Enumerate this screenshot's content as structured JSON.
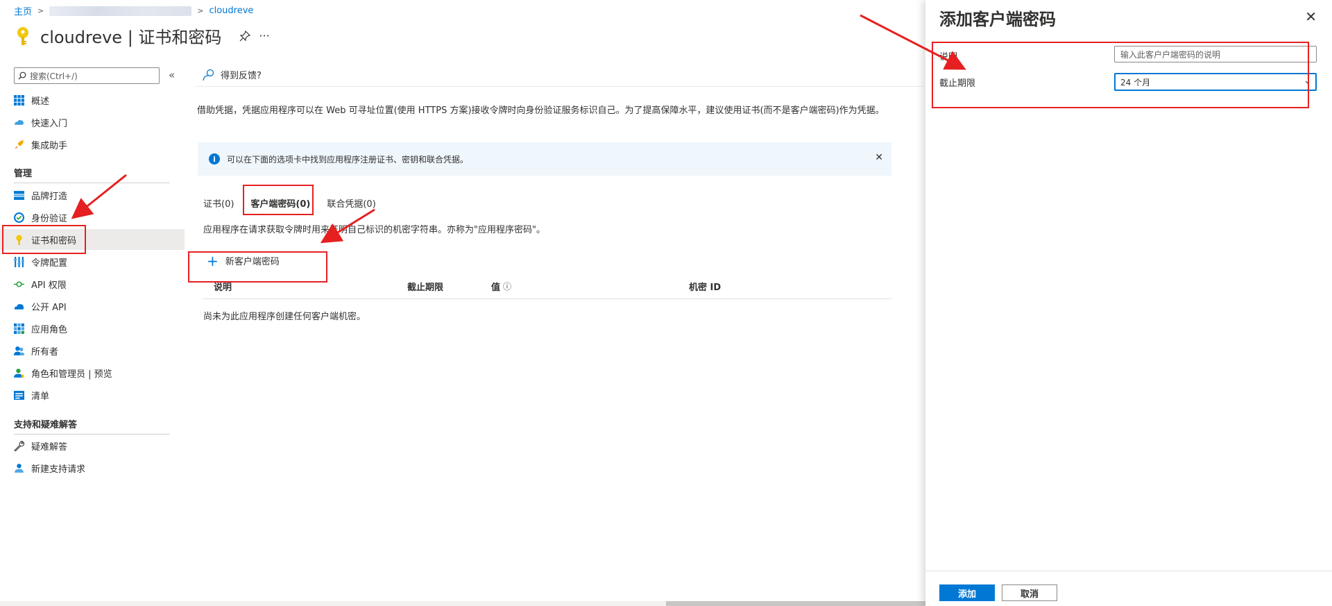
{
  "breadcrumb": {
    "home": "主页",
    "current": "cloudreve"
  },
  "header": {
    "title": "cloudreve | 证书和密码",
    "pin_icon": "pin-icon",
    "more_label": "···"
  },
  "sidebar": {
    "search_placeholder": "搜索(Ctrl+/)",
    "collapse_label": "«",
    "items_top": [
      {
        "label": "概述",
        "icon": "overview-icon"
      },
      {
        "label": "快速入门",
        "icon": "quickstart-icon"
      },
      {
        "label": "集成助手",
        "icon": "rocket-icon"
      }
    ],
    "section_manage": "管理",
    "items_manage": [
      {
        "label": "品牌打造",
        "icon": "branding-icon"
      },
      {
        "label": "身份验证",
        "icon": "auth-icon"
      },
      {
        "label": "证书和密码",
        "icon": "key-icon"
      },
      {
        "label": "令牌配置",
        "icon": "token-icon"
      },
      {
        "label": "API 权限",
        "icon": "api-permission-icon"
      },
      {
        "label": "公开 API",
        "icon": "cloud-icon"
      },
      {
        "label": "应用角色",
        "icon": "grid-icon"
      },
      {
        "label": "所有者",
        "icon": "owners-icon"
      },
      {
        "label": "角色和管理员 | 预览",
        "icon": "roles-icon"
      },
      {
        "label": "清单",
        "icon": "manifest-icon"
      }
    ],
    "section_support": "支持和疑难解答",
    "items_support": [
      {
        "label": "疑难解答",
        "icon": "wrench-icon"
      },
      {
        "label": "新建支持请求",
        "icon": "support-icon"
      }
    ]
  },
  "main": {
    "feedback_label": "得到反馈?",
    "description": "借助凭据，凭据应用程序可以在 Web 可寻址位置(使用 HTTPS 方案)接收令牌时向身份验证服务标识自己。为了提高保障水平，建议使用证书(而不是客户端密码)作为凭据。",
    "info_text": "可以在下面的选项卡中找到应用程序注册证书、密钥和联合凭据。",
    "tabs": [
      {
        "label": "证书(0)"
      },
      {
        "label": "客户端密码(0)"
      },
      {
        "label": "联合凭据(0)"
      }
    ],
    "tab_description": "应用程序在请求获取令牌时用来证明自己标识的机密字符串。亦称为\"应用程序密码\"。",
    "new_secret_label": "新客户端密码",
    "columns": [
      "说明",
      "截止期限",
      "值",
      "机密 ID"
    ],
    "value_info_icon": "ⓘ",
    "empty_message": "尚未为此应用程序创建任何客户端机密。"
  },
  "panel": {
    "title": "添加客户端密码",
    "close_label": "✕",
    "description_label": "说明",
    "description_placeholder": "输入此客户户端密码的说明",
    "expiry_label": "截止期限",
    "expiry_value": "24 个月",
    "add_button": "添加",
    "cancel_button": "取消"
  },
  "colors": {
    "accent": "#0078d4",
    "annotation_red": "#e62020"
  }
}
